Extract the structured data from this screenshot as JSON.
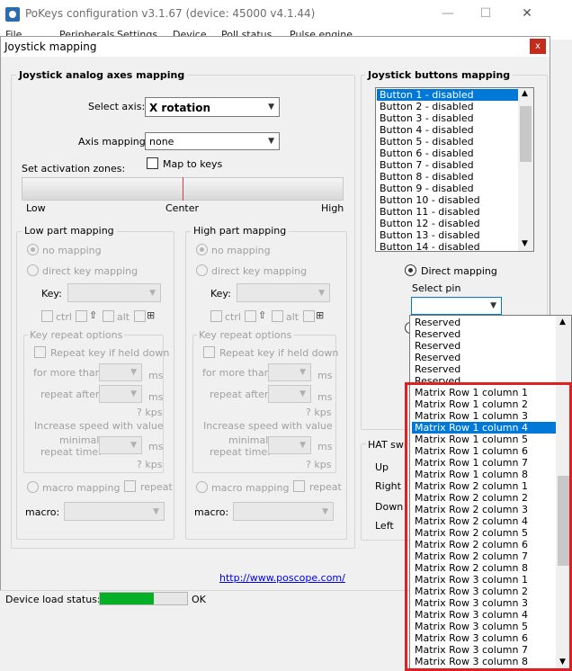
{
  "window": {
    "title": "PoKeys configuration v3.1.67 (device: 45000 v4.1.44)",
    "minimize": "—",
    "maximize": "☐",
    "close": "✕"
  },
  "menubar": [
    "File",
    "Peripherals",
    "Settings",
    "Device",
    "Poll status",
    "Pulse engine"
  ],
  "dialog": {
    "title": "Joystick mapping",
    "close": "x",
    "analog": {
      "title": "Joystick analog axes mapping",
      "select_axis_label": "Select axis:",
      "select_axis_value": "X rotation",
      "axis_mapping_label": "Axis mapping:",
      "axis_mapping_value": "none",
      "set_zones_label": "Set activation zones:",
      "map_to_keys_label": "Map to keys",
      "zone_low": "Low",
      "zone_center": "Center",
      "zone_high": "High"
    },
    "low_part": {
      "title": "Low part mapping",
      "no_mapping": "no mapping",
      "direct_key_mapping": "direct key mapping",
      "key_label": "Key:",
      "ctrl": "ctrl",
      "alt": "alt",
      "key_repeat_title": "Key repeat options",
      "repeat_if_held": "Repeat key if held down",
      "for_more_than": "for more than",
      "repeat_after": "repeat after",
      "ms": "ms",
      "kps": "? kps",
      "increase_speed": "Increase speed with value",
      "minimal": "minimal",
      "repeat_time": "repeat time:",
      "macro_mapping": "macro mapping",
      "repeat": "repeat",
      "macro_label": "macro:"
    },
    "high_part": {
      "title": "High part mapping",
      "no_mapping": "no mapping",
      "direct_key_mapping": "direct key mapping",
      "key_label": "Key:",
      "ctrl": "ctrl",
      "alt": "alt",
      "key_repeat_title": "Key repeat options",
      "repeat_if_held": "Repeat key if held down",
      "for_more_than": "for more than",
      "repeat_after": "repeat after",
      "ms": "ms",
      "kps": "? kps",
      "increase_speed": "Increase speed with value",
      "minimal": "minimal",
      "repeat_time": "repeat time:",
      "macro_mapping": "macro mapping",
      "repeat": "repeat",
      "macro_label": "macro:"
    },
    "buttons": {
      "title": "Joystick buttons mapping",
      "items": [
        "Button 1 - disabled",
        "Button 2 - disabled",
        "Button 3 - disabled",
        "Button 4 - disabled",
        "Button 5 - disabled",
        "Button 6 - disabled",
        "Button 7 - disabled",
        "Button 8 - disabled",
        "Button 9 - disabled",
        "Button 10 - disabled",
        "Button 11 - disabled",
        "Button 12 - disabled",
        "Button 13 - disabled",
        "Button 14 - disabled"
      ],
      "selected_index": 0,
      "direct_mapping": "Direct mapping",
      "select_pin": "Select pin"
    },
    "hat": {
      "title": "HAT swi",
      "up": "Up",
      "right": "Right",
      "down": "Down",
      "left": "Left"
    },
    "link": "http://www.poscope.com/"
  },
  "status": {
    "label": "Device load status:",
    "value": "OK",
    "progress": 0.62,
    "progress_color": "#06b025"
  },
  "pin_dropdown": {
    "items": [
      "Reserved",
      "Reserved",
      "Reserved",
      "Reserved",
      "Reserved",
      "Reserved",
      "Matrix Row 1 column 1",
      "Matrix Row 1 column 2",
      "Matrix Row 1 column 3",
      "Matrix Row 1 column 4",
      "Matrix Row 1 column 5",
      "Matrix Row 1 column 6",
      "Matrix Row 1 column 7",
      "Matrix Row 1 column 8",
      "Matrix Row 2 column 1",
      "Matrix Row 2 column 2",
      "Matrix Row 2 column 3",
      "Matrix Row 2 column 4",
      "Matrix Row 2 column 5",
      "Matrix Row 2 column 6",
      "Matrix Row 2 column 7",
      "Matrix Row 2 column 8",
      "Matrix Row 3 column 1",
      "Matrix Row 3 column 2",
      "Matrix Row 3 column 3",
      "Matrix Row 3 column 4",
      "Matrix Row 3 column 5",
      "Matrix Row 3 column 6",
      "Matrix Row 3 column 7",
      "Matrix Row 3 column 8"
    ],
    "selected_index": 9,
    "highlight_color": "#e02020"
  }
}
